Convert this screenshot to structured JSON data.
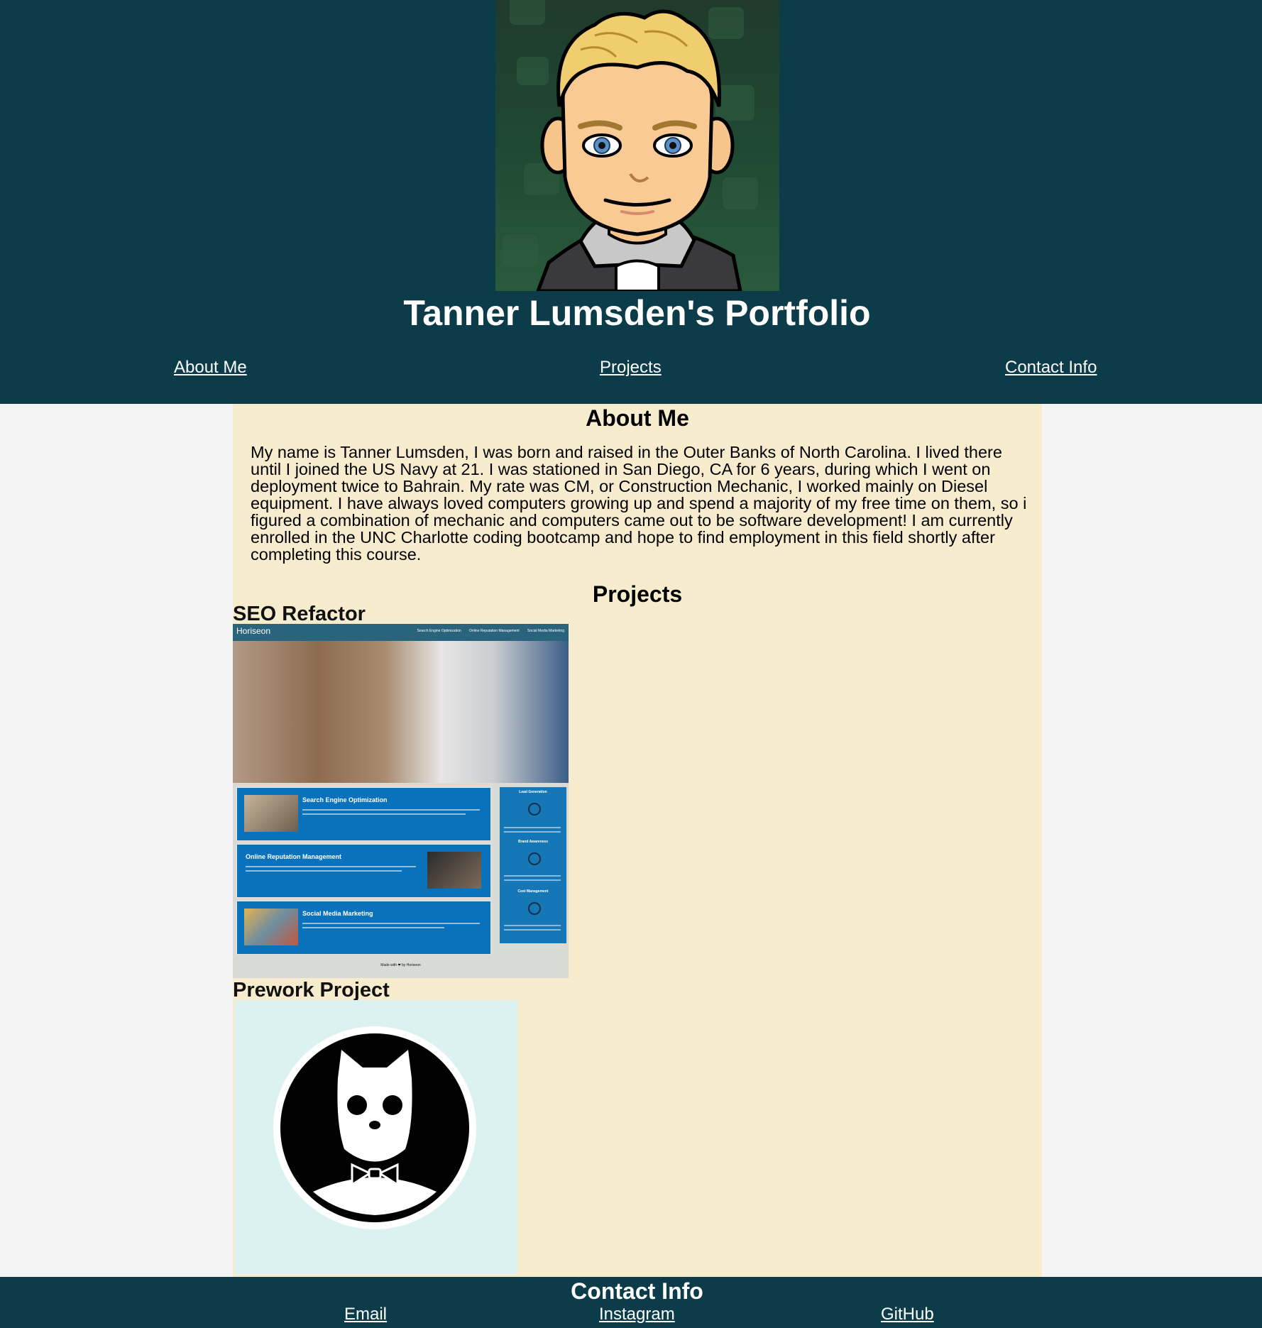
{
  "header": {
    "title": "Tanner Lumsden's Portfolio",
    "nav": [
      {
        "label": "About Me"
      },
      {
        "label": "Projects"
      },
      {
        "label": "Contact Info"
      }
    ]
  },
  "about": {
    "heading": "About Me",
    "text": "My name is Tanner Lumsden, I was born and raised in the Outer Banks of North Carolina. I lived there until I joined the US Navy at 21. I was stationed in San Diego, CA for 6 years, during which I went on deployment twice to Bahrain. My rate was CM, or Construction Mechanic, I worked mainly on Diesel equipment. I have always loved computers growing up and spend a majority of my free time on them, so i figured a combination of mechanic and computers came out to be software development! I am currently enrolled in the UNC Charlotte coding bootcamp and hope to find employment in this field shortly after completing this course."
  },
  "projects": {
    "heading": "Projects",
    "items": [
      {
        "title": "SEO Refactor",
        "screenshot": {
          "logo": "Horiseon",
          "nav": [
            "Search Engine Optimization",
            "Online Reputation Management",
            "Social Media Marketing"
          ],
          "cards": [
            "Search Engine Optimization",
            "Online Reputation Management",
            "Social Media Marketing"
          ],
          "sidebar": [
            "Lead Generation",
            "Brand Awareness",
            "Cost Management"
          ],
          "footer": "Made with ❤ by Horiseon"
        }
      },
      {
        "title": "Prework Project",
        "icon": "github-octocat-cat-icon"
      }
    ]
  },
  "footer": {
    "heading": "Contact Info",
    "links": [
      {
        "label": "Email"
      },
      {
        "label": "Instagram"
      },
      {
        "label": "GitHub"
      }
    ]
  },
  "colors": {
    "header_bg": "#0c3c4a",
    "main_bg": "#f8ecce",
    "page_bg": "#f4f4f4",
    "link": "#ffffff"
  }
}
